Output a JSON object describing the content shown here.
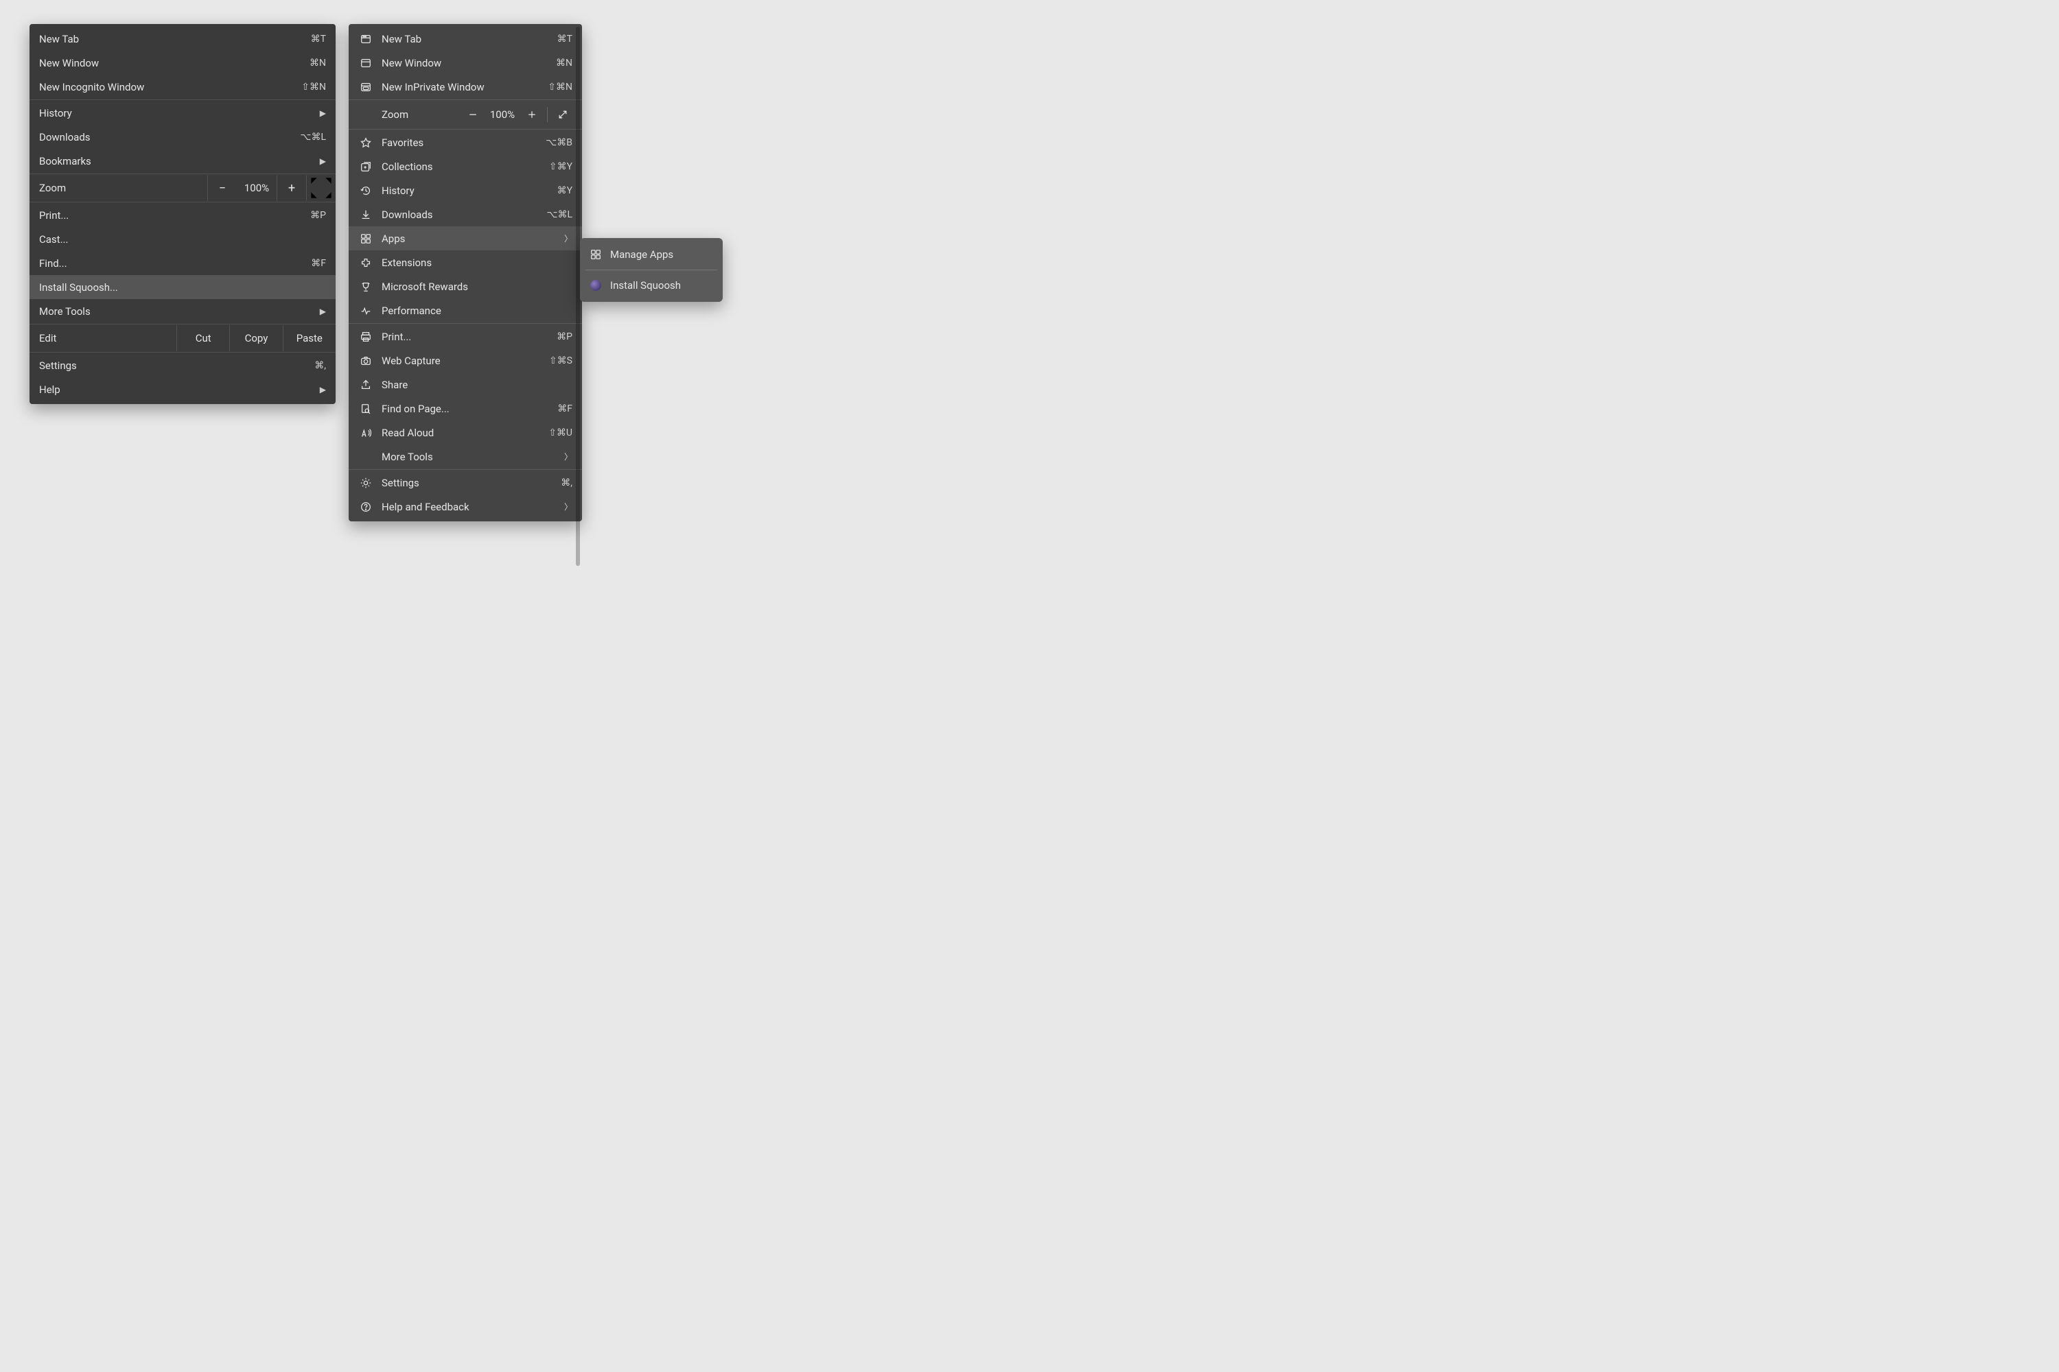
{
  "chrome": {
    "items": {
      "new_tab": {
        "label": "New Tab",
        "shortcut": "⌘T"
      },
      "new_window": {
        "label": "New Window",
        "shortcut": "⌘N"
      },
      "incognito": {
        "label": "New Incognito Window",
        "shortcut": "⇧⌘N"
      },
      "history": {
        "label": "History"
      },
      "downloads": {
        "label": "Downloads",
        "shortcut": "⌥⌘L"
      },
      "bookmarks": {
        "label": "Bookmarks"
      },
      "zoom": {
        "label": "Zoom",
        "value": "100%",
        "minus": "−",
        "plus": "+"
      },
      "print": {
        "label": "Print...",
        "shortcut": "⌘P"
      },
      "cast": {
        "label": "Cast..."
      },
      "find": {
        "label": "Find...",
        "shortcut": "⌘F"
      },
      "install": {
        "label": "Install Squoosh..."
      },
      "more_tools": {
        "label": "More Tools"
      },
      "edit": {
        "label": "Edit",
        "cut": "Cut",
        "copy": "Copy",
        "paste": "Paste"
      },
      "settings": {
        "label": "Settings",
        "shortcut": "⌘,"
      },
      "help": {
        "label": "Help"
      }
    }
  },
  "edge": {
    "items": {
      "new_tab": {
        "label": "New Tab",
        "shortcut": "⌘T"
      },
      "new_window": {
        "label": "New Window",
        "shortcut": "⌘N"
      },
      "inprivate": {
        "label": "New InPrivate Window",
        "shortcut": "⇧⌘N"
      },
      "zoom": {
        "label": "Zoom",
        "value": "100%"
      },
      "favorites": {
        "label": "Favorites",
        "shortcut": "⌥⌘B"
      },
      "collections": {
        "label": "Collections",
        "shortcut": "⇧⌘Y"
      },
      "history": {
        "label": "History",
        "shortcut": "⌘Y"
      },
      "downloads": {
        "label": "Downloads",
        "shortcut": "⌥⌘L"
      },
      "apps": {
        "label": "Apps"
      },
      "extensions": {
        "label": "Extensions"
      },
      "rewards": {
        "label": "Microsoft Rewards"
      },
      "performance": {
        "label": "Performance"
      },
      "print": {
        "label": "Print...",
        "shortcut": "⌘P"
      },
      "web_capture": {
        "label": "Web Capture",
        "shortcut": "⇧⌘S"
      },
      "share": {
        "label": "Share"
      },
      "find": {
        "label": "Find on Page...",
        "shortcut": "⌘F"
      },
      "read_aloud": {
        "label": "Read Aloud",
        "shortcut": "⇧⌘U"
      },
      "more_tools": {
        "label": "More Tools"
      },
      "settings": {
        "label": "Settings",
        "shortcut": "⌘,"
      },
      "help": {
        "label": "Help and Feedback"
      }
    },
    "submenu": {
      "manage": {
        "label": "Manage Apps"
      },
      "install": {
        "label": "Install Squoosh"
      }
    }
  }
}
